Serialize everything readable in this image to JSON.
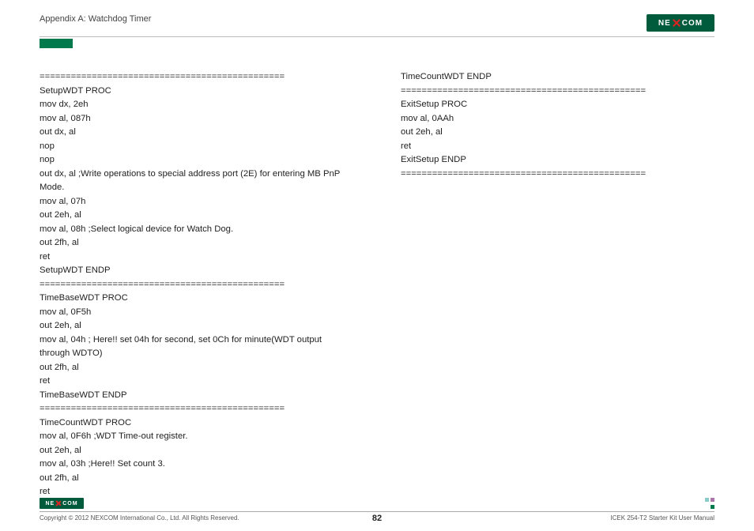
{
  "header": {
    "appendix": "Appendix A: Watchdog Timer",
    "logo_text_left": "NE",
    "logo_text_right": "COM"
  },
  "code_left": [
    "===============================================",
    "SetupWDT PROC",
    "mov dx, 2eh",
    "mov al, 087h",
    "out dx, al",
    "nop",
    "nop",
    "out dx, al ;Write operations to special address port (2E) for entering MB PnP Mode.",
    "mov al, 07h",
    "out 2eh, al",
    "mov al, 08h ;Select logical device for Watch Dog.",
    "out 2fh, al",
    "ret",
    "SetupWDT ENDP",
    "===============================================",
    "TimeBaseWDT PROC",
    "mov al, 0F5h",
    "out 2eh, al",
    "mov al, 04h ; Here!! set 04h for second, set 0Ch for minute(WDT output through WDTO)",
    "out 2fh, al",
    "ret",
    "TimeBaseWDT ENDP",
    "===============================================",
    "TimeCountWDT PROC",
    "mov al, 0F6h ;WDT Time-out register.",
    "out 2eh, al",
    "mov al, 03h ;Here!! Set count 3.",
    "out 2fh, al",
    "ret"
  ],
  "code_right": [
    "TimeCountWDT ENDP",
    "===============================================",
    "ExitSetup PROC",
    "mov al, 0AAh",
    "out 2eh, al",
    "ret",
    "ExitSetup ENDP",
    "==============================================="
  ],
  "footer": {
    "copyright": "Copyright © 2012 NEXCOM International Co., Ltd. All Rights Reserved.",
    "page": "82",
    "manual": "ICEK 254-T2 Starter Kit User Manual",
    "logo_text_left": "NE",
    "logo_text_right": "COM"
  }
}
